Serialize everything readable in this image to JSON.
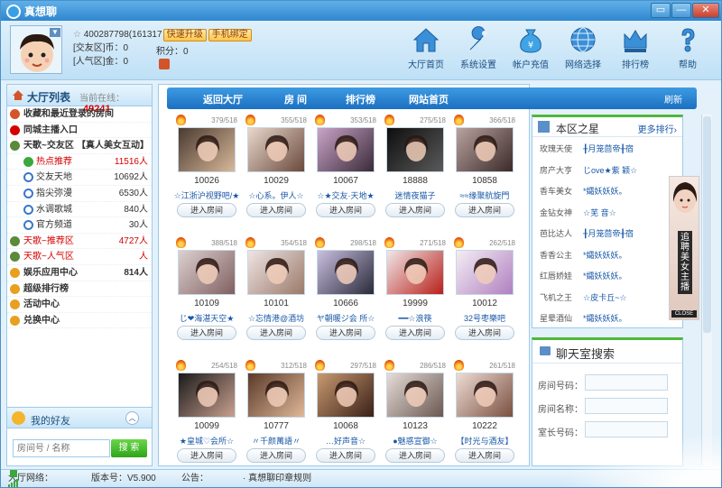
{
  "app": {
    "title": "真想聊"
  },
  "window": {
    "restore": "▭",
    "minimize": "—",
    "close": "✕"
  },
  "user": {
    "id": "400287798(161317",
    "upgrade": "快速升级",
    "bind_phone": "手机绑定",
    "coins_label": "[交友区]币：0",
    "popularity_label": "[人气区]金：0",
    "points_label": "积分：0"
  },
  "toolbar": [
    {
      "label": "大厅首页",
      "icon": "home-icon"
    },
    {
      "label": "系统设置",
      "icon": "wrench-icon"
    },
    {
      "label": "帐户充值",
      "icon": "money-bag-icon"
    },
    {
      "label": "网络选择",
      "icon": "globe-icon"
    },
    {
      "label": "排行榜",
      "icon": "crown-icon"
    },
    {
      "label": "帮助",
      "icon": "help-icon"
    }
  ],
  "hall": {
    "title": "大厅列表",
    "online_label": "当前在线：",
    "online_count": "49241",
    "items": [
      {
        "label": "收藏和最近登录的房间",
        "bold": true
      },
      {
        "label": "同城主播入口",
        "bold": true
      },
      {
        "label": "天歌~交友区",
        "tag": "【真人美女互动】",
        "bold": true
      },
      {
        "label": "热点推荐",
        "count": "11516人",
        "red": true,
        "lvl2": true
      },
      {
        "label": "交友天地",
        "count": "10692人",
        "lvl2": true
      },
      {
        "label": "指尖弥漫",
        "count": "6530人",
        "lvl2": true
      },
      {
        "label": "水调歌城",
        "count": "840人",
        "lvl2": true
      },
      {
        "label": "官方频道",
        "count": "30人",
        "lvl2": true
      },
      {
        "label": "天歌~推荐区",
        "count": "4727人",
        "red": true
      },
      {
        "label": "天歌~人气区",
        "count": "人",
        "red": true
      },
      {
        "label": "娱乐应用中心",
        "count": "814人",
        "bold": true
      },
      {
        "label": "超级排行榜",
        "bold": true
      },
      {
        "label": "活动中心",
        "bold": true
      },
      {
        "label": "兑换中心",
        "bold": true
      }
    ]
  },
  "friends": {
    "title": "我的好友",
    "search_placeholder": "房间号 / 名称",
    "search_button": "搜 索"
  },
  "tabs": [
    "返回大厅",
    "房 间",
    "排行榜",
    "网站首页"
  ],
  "refresh": "刷新",
  "rooms": [
    {
      "cap": "379/518",
      "id": "10026",
      "name": "☆江浙沪视野吧/★",
      "c1": "#4a3a30",
      "c2": "#d8b89a"
    },
    {
      "cap": "355/518",
      "id": "10029",
      "name": "☆心系。伊人☆",
      "c1": "#e9d7cc",
      "c2": "#6a4a3c"
    },
    {
      "cap": "353/518",
      "id": "10067",
      "name": "☆★交友·天地★",
      "c1": "#c9a4c8",
      "c2": "#3a2a38"
    },
    {
      "cap": "275/518",
      "id": "18888",
      "name": "迷情夜猫子",
      "c1": "#0e0e0e",
      "c2": "#5a5a5a"
    },
    {
      "cap": "366/518",
      "id": "10858",
      "name": "≈≈缘聚航旋門",
      "c1": "#b9a2a0",
      "c2": "#3a2a28"
    },
    {
      "cap": "388/518",
      "id": "10109",
      "name": "じ❤海湛天空★",
      "c1": "#ddd0d0",
      "c2": "#806060"
    },
    {
      "cap": "354/518",
      "id": "10101",
      "name": "☆忘情港@酒坊",
      "c1": "#efe4e4",
      "c2": "#9a7a6a"
    },
    {
      "cap": "298/518",
      "id": "10666",
      "name": "ヤ朝暖ジ会 所☆",
      "c1": "#c9c0e0",
      "c2": "#2a2a3a"
    },
    {
      "cap": "271/518",
      "id": "19999",
      "name": "━━☆浪筷",
      "c1": "#f0e8e8",
      "c2": "#b8201a"
    },
    {
      "cap": "262/518",
      "id": "10012",
      "name": "32号枣樂吧",
      "c1": "#f4eef4",
      "c2": "#b080c0"
    },
    {
      "cap": "254/518",
      "id": "10099",
      "name": "★皇城♡会所☆",
      "c1": "#1a1a1a",
      "c2": "#caa090"
    },
    {
      "cap": "312/518",
      "id": "10777",
      "name": "〃千颜萬語〃",
      "c1": "#5a3a2a",
      "c2": "#e0b898"
    },
    {
      "cap": "297/518",
      "id": "10068",
      "name": "…好声音☆",
      "c1": "#c89a70",
      "c2": "#3a2018"
    },
    {
      "cap": "286/518",
      "id": "10123",
      "name": "●魅惑宣御☆",
      "c1": "#e6dcd8",
      "c2": "#6a5850"
    },
    {
      "cap": "261/518",
      "id": "10222",
      "name": "【时光与酒友】",
      "c1": "#eedcd4",
      "c2": "#7a5040"
    }
  ],
  "enter_label": "进入房间",
  "star": {
    "title": "本区之星",
    "more": "更多排行›",
    "items": [
      {
        "k": "玫瑰天使",
        "v": "╂月笼茴帝╂宿"
      },
      {
        "k": "房产大亨",
        "v": "じove★紫 颖☆"
      },
      {
        "k": "香车美女",
        "v": "*孀妖妖妖。"
      },
      {
        "k": "金钻女神",
        "v": "☆芜 音☆"
      },
      {
        "k": "芭比达人",
        "v": "╂月笼茴帝╂宿"
      },
      {
        "k": "香香公主",
        "v": "*孀妖妖妖。"
      },
      {
        "k": "红唇娇娃",
        "v": "*孀妖妖妖。"
      },
      {
        "k": "飞机之王",
        "v": "☆皮卡丘~☆"
      },
      {
        "k": "星晕酒仙",
        "v": "*孀妖妖妖。"
      }
    ]
  },
  "ad": {
    "text": "追聘美女主播",
    "close": "CLOSE"
  },
  "chat_search": {
    "title": "聊天室搜索",
    "fields": [
      "房间号码：",
      "房间名称：",
      "室长号码："
    ]
  },
  "status": {
    "net": "大厅网络：",
    "version": "版本号：V5.900",
    "notice": "公告：",
    "rules": "· 真想聊印章规则"
  }
}
